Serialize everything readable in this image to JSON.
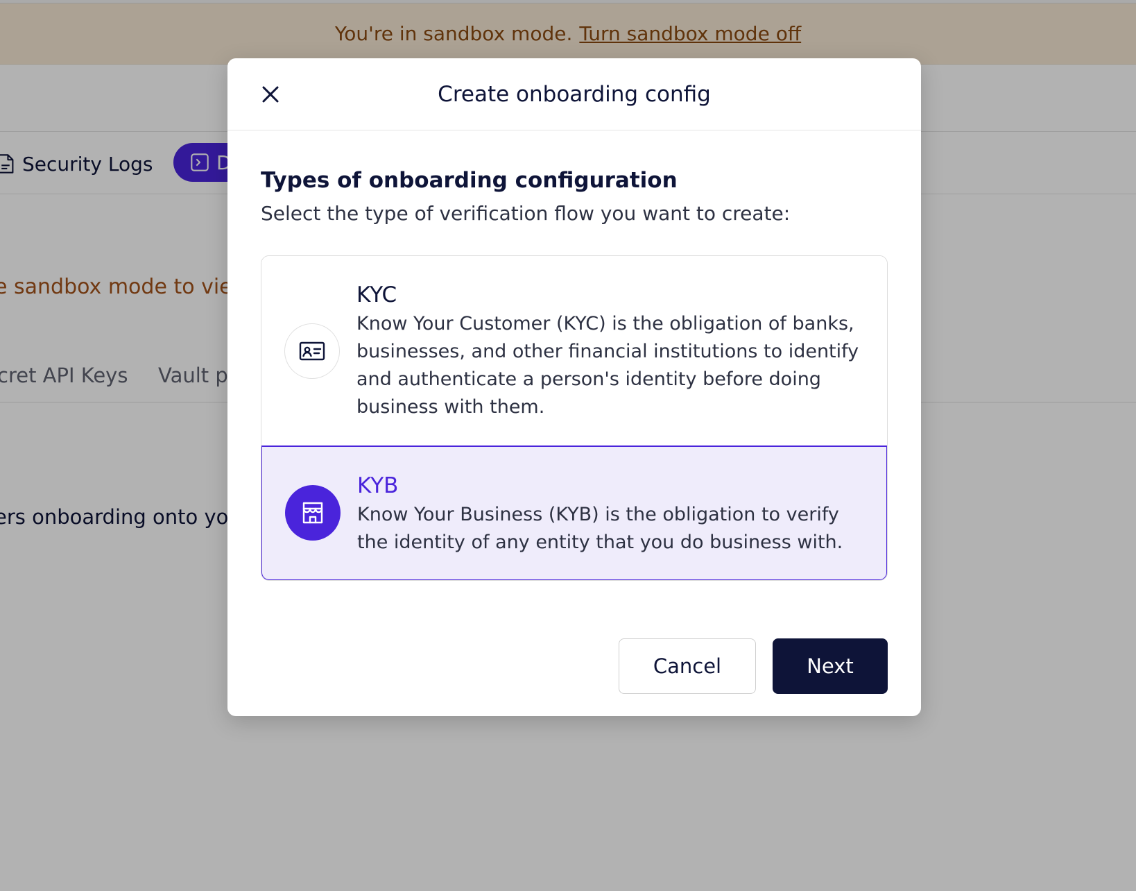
{
  "banner": {
    "text": "You're in sandbox mode.",
    "link": "Turn sandbox mode off"
  },
  "background": {
    "nav_security_logs": "Security Logs",
    "nav_pill_label": "D",
    "notice": "e sandbox mode to vie",
    "tabs": [
      "cret API Keys",
      "Vault pr"
    ],
    "description": "ers onboarding onto you"
  },
  "modal": {
    "title": "Create onboarding config",
    "section_title": "Types of onboarding configuration",
    "section_subtitle": "Select the type of verification flow you want to create:",
    "options": [
      {
        "title": "KYC",
        "description": "Know Your Customer (KYC) is the obligation of banks, businesses, and other financial institutions to identify and authenticate a person's identity before doing business with them.",
        "icon": "id-card-icon",
        "selected": false
      },
      {
        "title": "KYB",
        "description": "Know Your Business (KYB) is the obligation to verify the identity of any entity that you do business with.",
        "icon": "storefront-icon",
        "selected": true
      }
    ],
    "cancel_label": "Cancel",
    "next_label": "Next"
  },
  "colors": {
    "accent": "#4a24db",
    "primary_dark": "#0e1438",
    "selected_bg": "#efecfb",
    "sandbox_text": "#8a4a10"
  }
}
